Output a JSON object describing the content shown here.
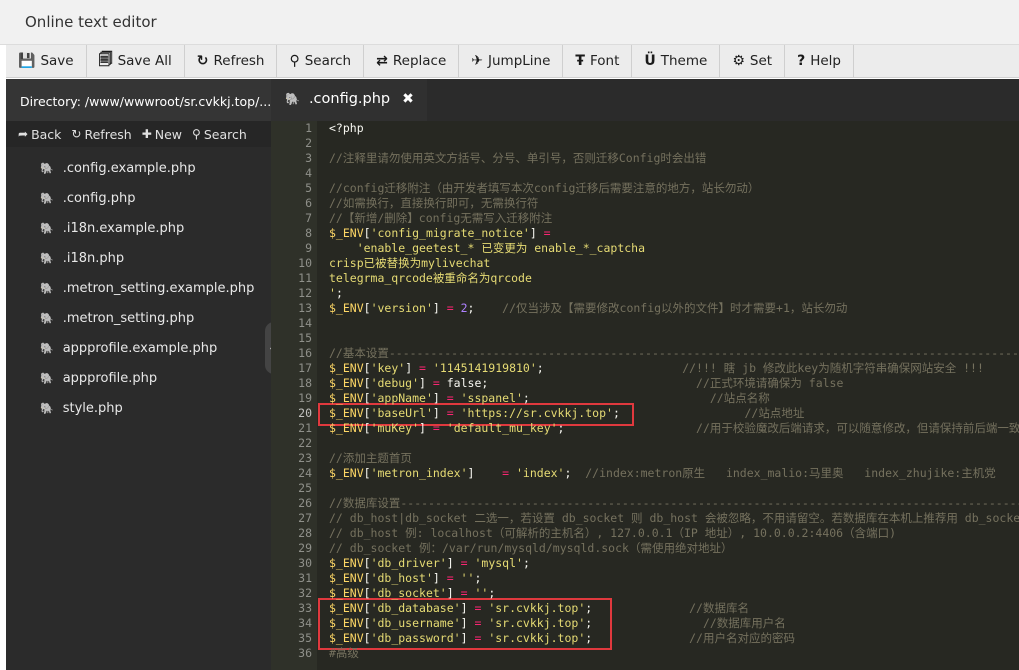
{
  "window": {
    "title": "Online text editor"
  },
  "toolbar": [
    {
      "icon": "save-icon",
      "glyph": "💾",
      "label": "Save"
    },
    {
      "icon": "save-all-icon",
      "glyph": "🗐",
      "label": "Save All"
    },
    {
      "icon": "refresh-icon",
      "glyph": "↻",
      "label": "Refresh"
    },
    {
      "icon": "search-icon",
      "glyph": "⚲",
      "label": "Search"
    },
    {
      "icon": "replace-icon",
      "glyph": "⇄",
      "label": "Replace"
    },
    {
      "icon": "jumpline-icon",
      "glyph": "✈",
      "label": "JumpLine"
    },
    {
      "icon": "font-icon",
      "glyph": "Ŧ",
      "label": "Font"
    },
    {
      "icon": "theme-icon",
      "glyph": "Ü",
      "label": "Theme"
    },
    {
      "icon": "gear-icon",
      "glyph": "⚙",
      "label": "Set"
    },
    {
      "icon": "help-icon",
      "glyph": "?",
      "label": "Help"
    }
  ],
  "sidebar": {
    "directory": "Directory: /www/wwwroot/sr.cvkkj.top/...",
    "actions": [
      {
        "icon": "back-icon",
        "glyph": "➦",
        "label": "Back"
      },
      {
        "icon": "refresh-icon",
        "glyph": "↻",
        "label": "Refresh"
      },
      {
        "icon": "plus-icon",
        "glyph": "✚",
        "label": "New"
      },
      {
        "icon": "search-icon",
        "glyph": "⚲",
        "label": "Search"
      }
    ],
    "files": [
      ".config.example.php",
      ".config.php",
      ".i18n.example.php",
      ".i18n.php",
      ".metron_setting.example.php",
      ".metron_setting.php",
      "appprofile.example.php",
      "appprofile.php",
      "style.php"
    ]
  },
  "tab": {
    "label": ".config.php",
    "close": "✖",
    "icon": "php-elephant-icon"
  },
  "collapse_glyph": "❮",
  "editor": {
    "active_line": 20,
    "lines": [
      {
        "n": 1,
        "t": "<?php"
      },
      {
        "n": 2,
        "t": ""
      },
      {
        "n": 3,
        "t": "//注释里请勿使用英文方括号、分号、单引号，否则迁移Config时会出错"
      },
      {
        "n": 4,
        "t": ""
      },
      {
        "n": 5,
        "t": "//config迁移附注（由开发者填写本次config迁移后需要注意的地方，站长勿动）"
      },
      {
        "n": 6,
        "t": "//如需换行，直接换行即可，无需换行符"
      },
      {
        "n": 7,
        "t": "//【新增/删除】config无需写入迁移附注"
      },
      {
        "n": 8,
        "t": "$_ENV['config_migrate_notice'] ="
      },
      {
        "n": 9,
        "t": "    'enable_geetest_* 已变更为 enable_*_captcha"
      },
      {
        "n": 10,
        "t": "crisp已被替换为mylivechat"
      },
      {
        "n": 11,
        "t": "telegrma_qrcode被重命名为qrcode"
      },
      {
        "n": 12,
        "t": "';"
      },
      {
        "n": 13,
        "t": "$_ENV['version'] = 2;    //仅当涉及【需要修改config以外的文件】时才需要+1，站长勿动"
      },
      {
        "n": 14,
        "t": ""
      },
      {
        "n": 15,
        "t": ""
      },
      {
        "n": 16,
        "t": "//基本设置--------------------------------------------------------------------------------------------"
      },
      {
        "n": 17,
        "t": "$_ENV['key'] = '1145141919810';                    //!!! 瞎 jb 修改此key为随机字符串确保网站安全 !!!"
      },
      {
        "n": 18,
        "t": "$_ENV['debug'] = false;                              //正式环境请确保为 false"
      },
      {
        "n": 19,
        "t": "$_ENV['appName'] = 'sspanel';                          //站点名称"
      },
      {
        "n": 20,
        "t": "$_ENV['baseUrl'] = 'https://sr.cvkkj.top';                  //站点地址"
      },
      {
        "n": 21,
        "t": "$_ENV['muKey'] = 'default_mu_key';                   //用于校验魔改后端请求，可以随意修改，但请保持前后端一致，否则节点不能"
      },
      {
        "n": 22,
        "t": ""
      },
      {
        "n": 23,
        "t": "//添加主题首页"
      },
      {
        "n": 24,
        "t": "$_ENV['metron_index']    = 'index';  //index:metron原生   index_malio:马里奥   index_zhujike:主机党"
      },
      {
        "n": 25,
        "t": ""
      },
      {
        "n": 26,
        "t": "//数据库设置--------------------------------------------------------------------------------------------"
      },
      {
        "n": 27,
        "t": "// db_host|db_socket 二选一，若设置 db_socket 则 db_host 会被忽略，不用请留空。若数据库在本机上推荐用 db_socke"
      },
      {
        "n": 28,
        "t": "// db_host 例: localhost（可解析的主机名）, 127.0.0.1（IP 地址）, 10.0.0.2:4406（含端口)"
      },
      {
        "n": 29,
        "t": "// db_socket 例：/var/run/mysqld/mysqld.sock（需使用绝对地址）"
      },
      {
        "n": 30,
        "t": "$_ENV['db_driver'] = 'mysql';"
      },
      {
        "n": 31,
        "t": "$_ENV['db_host'] = '';"
      },
      {
        "n": 32,
        "t": "$_ENV['db_socket'] = '';"
      },
      {
        "n": 33,
        "t": "$_ENV['db_database'] = 'sr.cvkkj.top';              //数据库名"
      },
      {
        "n": 34,
        "t": "$_ENV['db_username'] = 'sr.cvkkj.top';                //数据库用户名"
      },
      {
        "n": 35,
        "t": "$_ENV['db_password'] = 'sr.cvkkj.top';              //用户名对应的密码"
      },
      {
        "n": 36,
        "t": "#高级"
      }
    ]
  },
  "colors": {
    "editor_bg": "#272822",
    "sidebar_bg": "#2b2b2b",
    "highlight_box": "#e0393e",
    "file_icon": "#4b91c9"
  }
}
